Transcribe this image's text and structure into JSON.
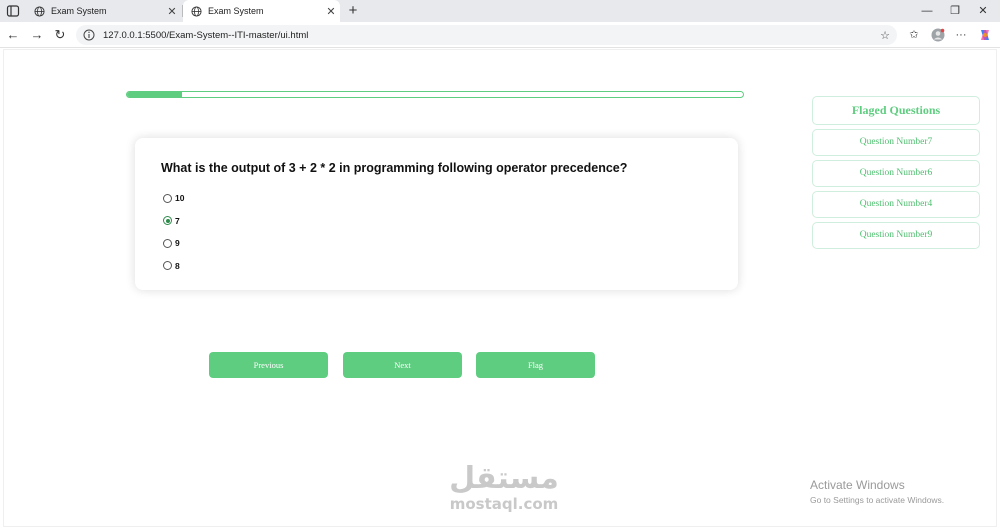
{
  "browser": {
    "tabs": [
      {
        "title": "Exam System",
        "active": false
      },
      {
        "title": "Exam System",
        "active": true
      }
    ],
    "url": "127.0.0.1:5500/Exam-System--ITI-master/ui.html"
  },
  "exam": {
    "progress_percent": 9,
    "question": "What is the output of 3 + 2 * 2 in programming following operator precedence?",
    "options": [
      {
        "label": "10",
        "selected": false
      },
      {
        "label": "7",
        "selected": true
      },
      {
        "label": "9",
        "selected": false
      },
      {
        "label": "8",
        "selected": false
      }
    ],
    "buttons": {
      "previous": "Previous",
      "next": "Next",
      "flag": "Flag"
    }
  },
  "flagged": {
    "title": "Flaged Questions",
    "items": [
      "Question Number7",
      "Question Number6",
      "Question Number4",
      "Question Number9"
    ]
  },
  "watermark": {
    "arabic": "مستقل",
    "latin": "mostaql.com"
  },
  "activation": {
    "title": "Activate Windows",
    "subtitle": "Go to Settings to activate Windows."
  },
  "colors": {
    "accent": "#5fcd80",
    "selected_radio": "#2e8b4a"
  }
}
